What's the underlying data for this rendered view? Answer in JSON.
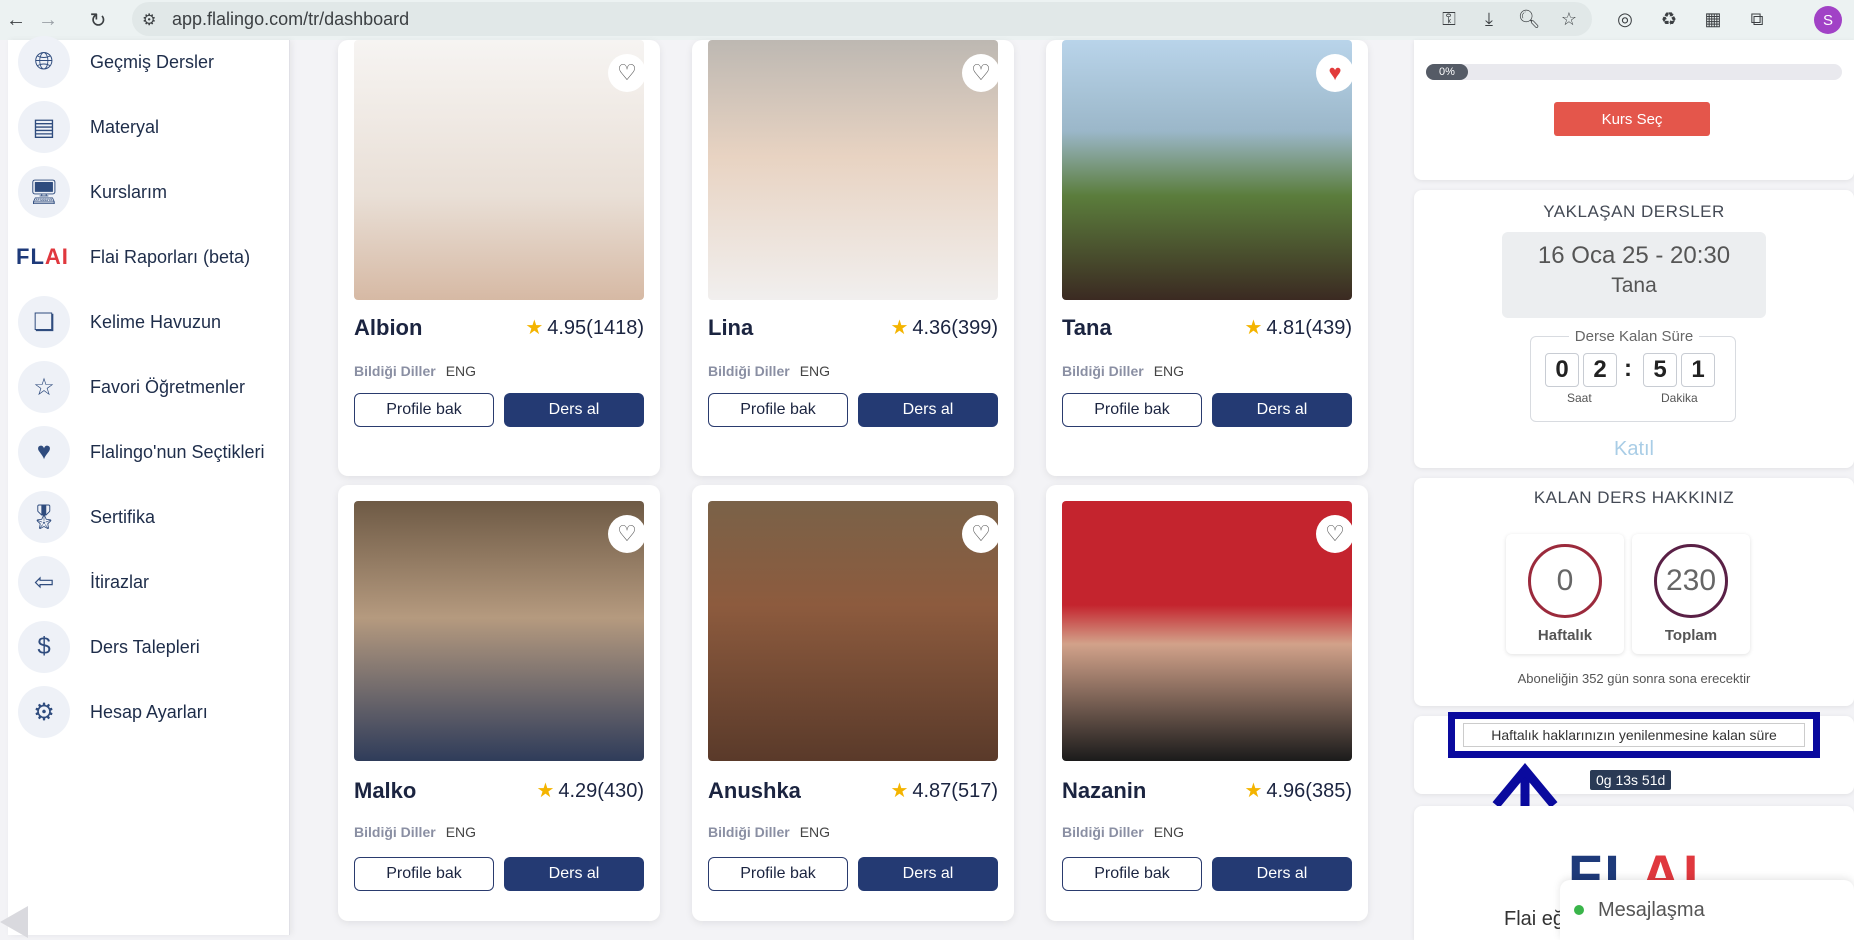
{
  "browser": {
    "url": "app.flalingo.com/tr/dashboard",
    "profile_initial": "S"
  },
  "sidebar": {
    "items": [
      {
        "label": "Geçmiş Dersler",
        "icon": "globe-icon"
      },
      {
        "label": "Materyal",
        "icon": "document-icon"
      },
      {
        "label": "Kurslarım",
        "icon": "monitor-icon"
      },
      {
        "label": "Flai Raporları (beta)",
        "icon": "flai-logo-icon"
      },
      {
        "label": "Kelime Havuzun",
        "icon": "vocabulary-icon"
      },
      {
        "label": "Favori Öğretmenler",
        "icon": "star-bookmark-icon"
      },
      {
        "label": "Flalingo'nun Seçtikleri",
        "icon": "people-heart-icon"
      },
      {
        "label": "Sertifika",
        "icon": "certificate-icon"
      },
      {
        "label": "İtirazlar",
        "icon": "objection-icon"
      },
      {
        "label": "Ders Talepleri",
        "icon": "request-icon"
      },
      {
        "label": "Hesap Ayarları",
        "icon": "gear-icon"
      }
    ],
    "flai_logo": {
      "fl": "FL",
      "ai": "AI"
    }
  },
  "teachers": {
    "langs_label": "Bildiği Diller",
    "profile_label": "Profile bak",
    "book_label": "Ders al",
    "list": [
      {
        "name": "Albion",
        "rating": "4.95(1418)",
        "lang": "ENG",
        "favorite": false
      },
      {
        "name": "Lina",
        "rating": "4.36(399)",
        "lang": "ENG",
        "favorite": false
      },
      {
        "name": "Tana",
        "rating": "4.81(439)",
        "lang": "ENG",
        "favorite": true
      },
      {
        "name": "Malko",
        "rating": "4.29(430)",
        "lang": "ENG",
        "favorite": false
      },
      {
        "name": "Anushka",
        "rating": "4.87(517)",
        "lang": "ENG",
        "favorite": false
      },
      {
        "name": "Nazanin",
        "rating": "4.96(385)",
        "lang": "ENG",
        "favorite": false
      }
    ]
  },
  "course": {
    "progress_label": "0%",
    "progress": 0,
    "select_button": "Kurs Seç"
  },
  "upcoming": {
    "title": "YAKLAŞAN DERSLER",
    "datetime": "16 Oca 25 - 20:30",
    "teacher": "Tana",
    "remaining_label": "Derse Kalan Süre",
    "digits": [
      "0",
      "2",
      "5",
      "1"
    ],
    "hours_label": "Saat",
    "minutes_label": "Dakika",
    "join_label": "Katıl"
  },
  "credits": {
    "title": "KALAN DERS HAKKINIZ",
    "weekly_value": "0",
    "weekly_label": "Haftalık",
    "total_value": "230",
    "total_label": "Toplam",
    "note": "Aboneliğin 352 gün sonra sona erecektir"
  },
  "renewal": {
    "label": "Haftalık haklarınızın yenilenmesine kalan süre",
    "time": "0g 13s 51d"
  },
  "promo": {
    "logo_fl": "FL",
    "logo_ai": "AI",
    "text": "Flai eğ"
  },
  "chat": {
    "label": "Mesajlaşma"
  },
  "colors": {
    "primary": "#243a73",
    "accent": "#e4564b",
    "highlight": "#0a0a9e"
  }
}
